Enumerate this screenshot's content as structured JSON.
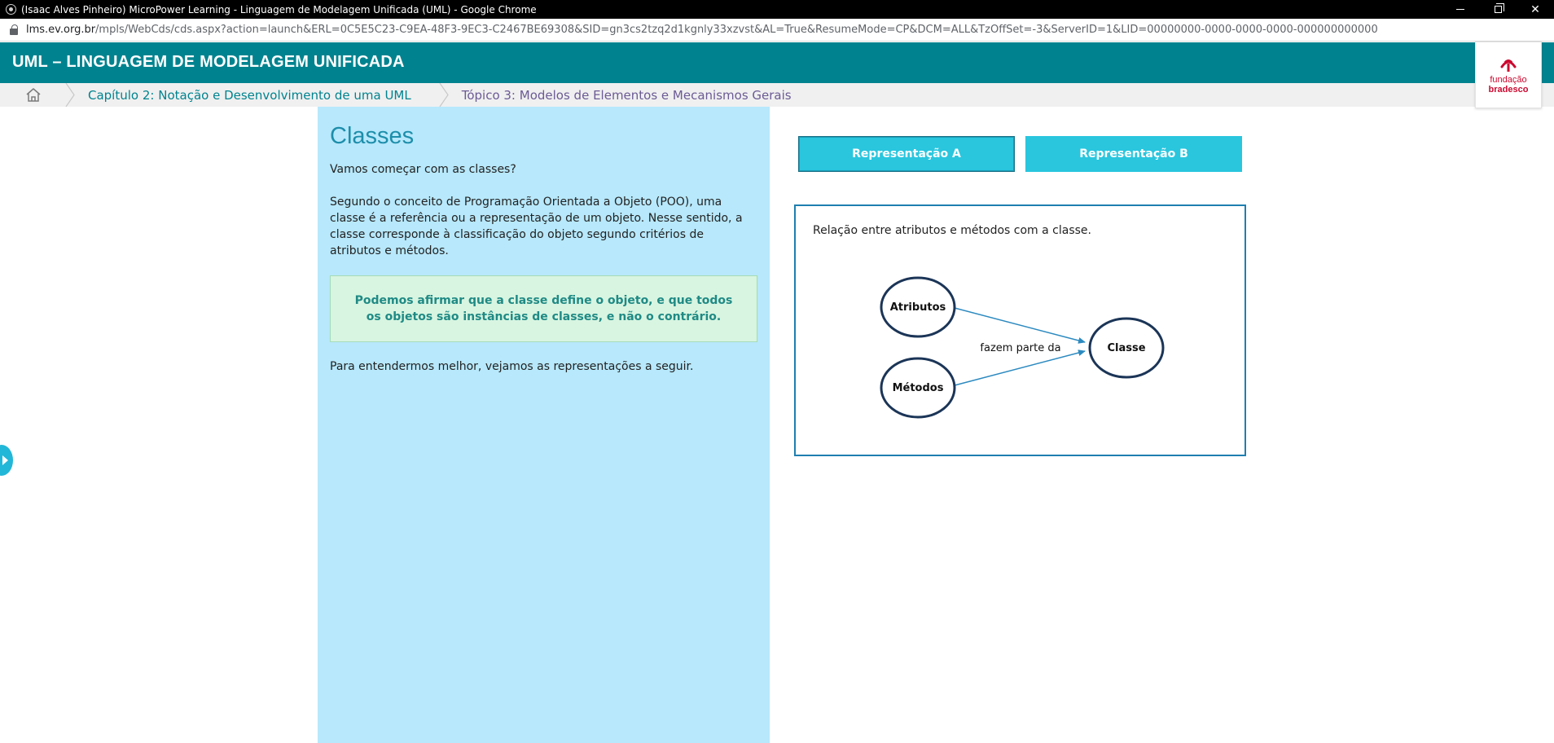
{
  "browser": {
    "window_title": "(Isaac Alves Pinheiro) MicroPower Learning - Linguagem de Modelagem Unificada (UML) - Google Chrome",
    "url_host": "lms.ev.org.br",
    "url_path": "/mpls/WebCds/cds.aspx?action=launch&ERL=0C5E5C23-C9EA-48F3-9EC3-C2467BE69308&SID=gn3cs2tzq2d1kgnly33xzvst&AL=True&ResumeMode=CP&DCM=ALL&TzOffSet=-3&ServerID=1&LID=00000000-0000-0000-0000-000000000000"
  },
  "header": {
    "title": "UML – LINGUAGEM DE MODELAGEM UNIFICADA",
    "logo_line1": "fundação",
    "logo_line2": "bradesco"
  },
  "breadcrumb": {
    "chapter": "Capítulo 2: Notação e Desenvolvimento de uma UML",
    "topic": "Tópico 3: Modelos de Elementos e Mecanismos Gerais"
  },
  "content": {
    "title": "Classes",
    "p1": "Vamos começar com as classes?",
    "p2": "Segundo o conceito de Programação Orientada a Objeto (POO), uma classe é a referência ou a representação de um objeto. Nesse sentido, a classe corresponde à classificação do objeto segundo critérios de atributos e métodos.",
    "highlight": "Podemos afirmar que a classe define o objeto, e que todos os objetos são instâncias de classes, e não o contrário.",
    "p3": "Para entendermos melhor, vejamos as representações a seguir."
  },
  "tabs": [
    {
      "label": "Representação A",
      "selected": true
    },
    {
      "label": "Representação B",
      "selected": false
    }
  ],
  "diagram": {
    "caption": "Relação entre atributos e métodos com a classe.",
    "nodes": {
      "atributos": "Atributos",
      "metodos": "Métodos",
      "classe": "Classe"
    },
    "edge_label": "fazem parte da"
  },
  "colors": {
    "header_teal": "#00838f",
    "panel_blue": "#b7e8fb",
    "tab_cyan": "#29c6de",
    "brand_red": "#cc092f",
    "arrow_blue": "#2c8ac0",
    "node_stroke": "#1b3557"
  },
  "icons": {
    "home": "home-icon",
    "lock": "lock-icon",
    "side_toggle": "chevron-right-icon"
  }
}
